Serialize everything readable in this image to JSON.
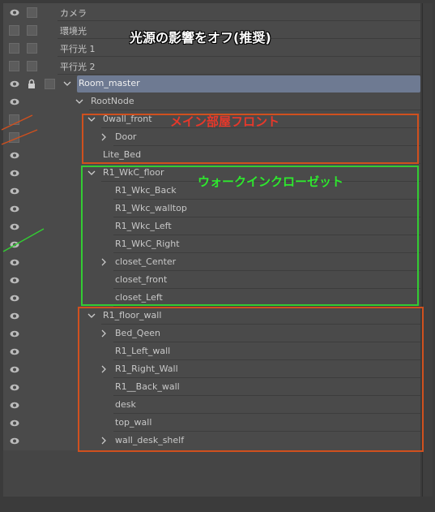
{
  "layers": [
    {
      "label": "カメラ"
    },
    {
      "label": "環境光"
    },
    {
      "label": "平行光 1"
    },
    {
      "label": "平行光 2"
    },
    {
      "label": "Room_master"
    },
    {
      "label": "RootNode"
    },
    {
      "label": "0wall_front"
    },
    {
      "label": "Door"
    },
    {
      "label": "Lite_Bed"
    },
    {
      "label": "R1_WkC_floor"
    },
    {
      "label": "R1_Wkc_Back"
    },
    {
      "label": "R1_Wkc_walltop"
    },
    {
      "label": "R1_Wkc_Left"
    },
    {
      "label": "R1_WkC_Right"
    },
    {
      "label": "closet_Center"
    },
    {
      "label": "closet_front"
    },
    {
      "label": "closet_Left"
    },
    {
      "label": "R1_floor_wall"
    },
    {
      "label": "Bed_Qeen"
    },
    {
      "label": "R1_Left_wall"
    },
    {
      "label": "R1_Right_Wall"
    },
    {
      "label": "R1__Back_wall"
    },
    {
      "label": "desk"
    },
    {
      "label": "top_wall"
    },
    {
      "label": "wall_desk_shelf"
    }
  ],
  "annotations": {
    "light_off": "光源の影響をオフ(推奨)",
    "main_room_front": "メイン部屋フロント",
    "walk_in_closet": "ウォークインクローゼット"
  },
  "colors": {
    "panel_bg": "#4a4a4a",
    "selected_row": "#6e7a92",
    "red_box": "#d0501e",
    "green_box": "#33cc33",
    "red_text": "#e8382a",
    "green_text": "#2ee82e",
    "white_text": "#ffffff"
  },
  "icons": {
    "visibility": "eye-icon",
    "lock": "lock-icon",
    "expanded": "chevron-down-icon",
    "collapsed": "chevron-right-icon"
  }
}
